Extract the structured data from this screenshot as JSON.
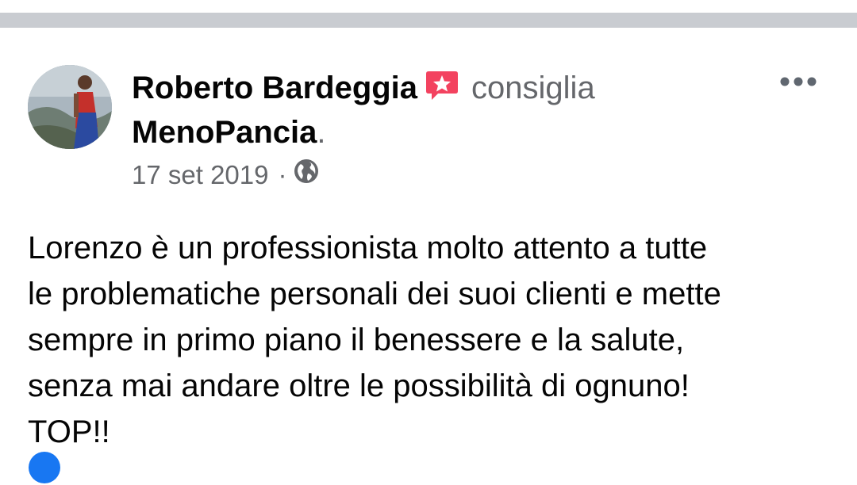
{
  "post": {
    "author": "Roberto Bardeggia",
    "action": "consiglia",
    "page": "MenoPancia",
    "period": ".",
    "date": "17 set 2019",
    "separator": "·",
    "visibility_icon": "globe-icon",
    "recommend_icon": "recommend-star-icon",
    "more_icon": "more-options-icon",
    "text": "Lorenzo è un professionista molto attento a tutte\nle problematiche personali dei suoi clienti e mette\nsempre in primo piano il benessere e la salute,\nsenza mai andare oltre le possibilità di ognuno!\nTOP!!"
  },
  "colors": {
    "recommend": "#f3425f",
    "meta_text": "#65676b",
    "divider": "#c9ccd1"
  }
}
